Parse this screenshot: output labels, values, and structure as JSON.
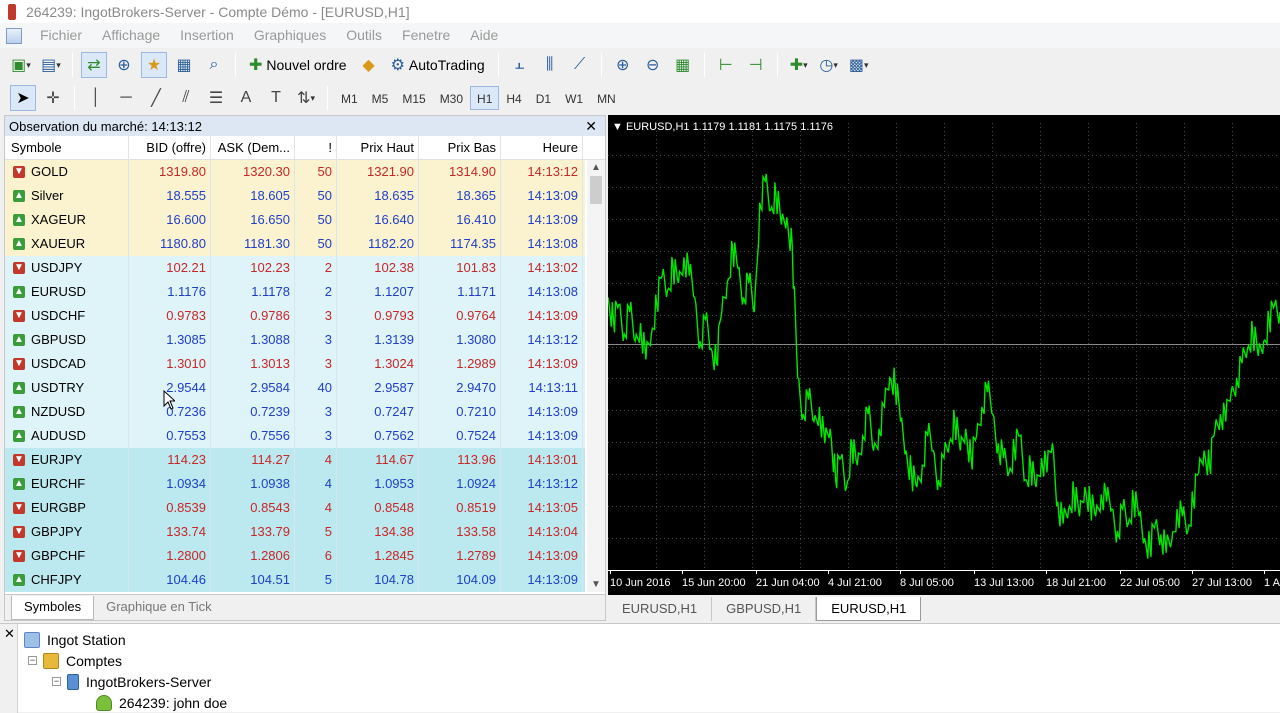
{
  "window": {
    "title": "264239: IngotBrokers-Server - Compte Démo - [EURUSD,H1]"
  },
  "menu": [
    "Fichier",
    "Affichage",
    "Insertion",
    "Graphiques",
    "Outils",
    "Fenetre",
    "Aide"
  ],
  "toolbar": {
    "new_order": "Nouvel ordre",
    "autotrading": "AutoTrading"
  },
  "periods": [
    "M1",
    "M5",
    "M15",
    "M30",
    "H1",
    "H4",
    "D1",
    "W1",
    "MN"
  ],
  "active_period": "H1",
  "market_watch": {
    "title": "Observation du marché: 14:13:12",
    "columns": {
      "symbol": "Symbole",
      "bid": "BID (offre)",
      "ask": "ASK (Dem...",
      "spread": "!",
      "high": "Prix Haut",
      "low": "Prix Bas",
      "time": "Heure"
    },
    "rows": [
      {
        "symbol": "GOLD",
        "dir": "down",
        "group": "metals",
        "bid": "1319.80",
        "ask": "1320.30",
        "spread": "50",
        "high": "1321.90",
        "low": "1314.90",
        "time": "14:13:12"
      },
      {
        "symbol": "Silver",
        "dir": "up",
        "group": "metals",
        "bid": "18.555",
        "ask": "18.605",
        "spread": "50",
        "high": "18.635",
        "low": "18.365",
        "time": "14:13:09"
      },
      {
        "symbol": "XAGEUR",
        "dir": "up",
        "group": "metals",
        "bid": "16.600",
        "ask": "16.650",
        "spread": "50",
        "high": "16.640",
        "low": "16.410",
        "time": "14:13:09"
      },
      {
        "symbol": "XAUEUR",
        "dir": "up",
        "group": "metals",
        "bid": "1180.80",
        "ask": "1181.30",
        "spread": "50",
        "high": "1182.20",
        "low": "1174.35",
        "time": "14:13:08"
      },
      {
        "symbol": "USDJPY",
        "dir": "down",
        "group": "majors",
        "bid": "102.21",
        "ask": "102.23",
        "spread": "2",
        "high": "102.38",
        "low": "101.83",
        "time": "14:13:02"
      },
      {
        "symbol": "EURUSD",
        "dir": "up",
        "group": "majors",
        "bid": "1.1176",
        "ask": "1.1178",
        "spread": "2",
        "high": "1.1207",
        "low": "1.1171",
        "time": "14:13:08"
      },
      {
        "symbol": "USDCHF",
        "dir": "down",
        "group": "majors",
        "bid": "0.9783",
        "ask": "0.9786",
        "spread": "3",
        "high": "0.9793",
        "low": "0.9764",
        "time": "14:13:09"
      },
      {
        "symbol": "GBPUSD",
        "dir": "up",
        "group": "majors",
        "bid": "1.3085",
        "ask": "1.3088",
        "spread": "3",
        "high": "1.3139",
        "low": "1.3080",
        "time": "14:13:12"
      },
      {
        "symbol": "USDCAD",
        "dir": "down",
        "group": "majors",
        "bid": "1.3010",
        "ask": "1.3013",
        "spread": "3",
        "high": "1.3024",
        "low": "1.2989",
        "time": "14:13:09"
      },
      {
        "symbol": "USDTRY",
        "dir": "up",
        "group": "majors",
        "bid": "2.9544",
        "ask": "2.9584",
        "spread": "40",
        "high": "2.9587",
        "low": "2.9470",
        "time": "14:13:11"
      },
      {
        "symbol": "NZDUSD",
        "dir": "up",
        "group": "majors",
        "bid": "0.7236",
        "ask": "0.7239",
        "spread": "3",
        "high": "0.7247",
        "low": "0.7210",
        "time": "14:13:09"
      },
      {
        "symbol": "AUDUSD",
        "dir": "up",
        "group": "majors",
        "bid": "0.7553",
        "ask": "0.7556",
        "spread": "3",
        "high": "0.7562",
        "low": "0.7524",
        "time": "14:13:09"
      },
      {
        "symbol": "EURJPY",
        "dir": "down",
        "group": "crosses",
        "bid": "114.23",
        "ask": "114.27",
        "spread": "4",
        "high": "114.67",
        "low": "113.96",
        "time": "14:13:01"
      },
      {
        "symbol": "EURCHF",
        "dir": "up",
        "group": "crosses",
        "bid": "1.0934",
        "ask": "1.0938",
        "spread": "4",
        "high": "1.0953",
        "low": "1.0924",
        "time": "14:13:12"
      },
      {
        "symbol": "EURGBP",
        "dir": "down",
        "group": "crosses",
        "bid": "0.8539",
        "ask": "0.8543",
        "spread": "4",
        "high": "0.8548",
        "low": "0.8519",
        "time": "14:13:05"
      },
      {
        "symbol": "GBPJPY",
        "dir": "down",
        "group": "crosses",
        "bid": "133.74",
        "ask": "133.79",
        "spread": "5",
        "high": "134.38",
        "low": "133.58",
        "time": "14:13:04"
      },
      {
        "symbol": "GBPCHF",
        "dir": "down",
        "group": "crosses",
        "bid": "1.2800",
        "ask": "1.2806",
        "spread": "6",
        "high": "1.2845",
        "low": "1.2789",
        "time": "14:13:09"
      },
      {
        "symbol": "CHFJPY",
        "dir": "up",
        "group": "crosses",
        "bid": "104.46",
        "ask": "104.51",
        "spread": "5",
        "high": "104.78",
        "low": "104.09",
        "time": "14:13:09"
      }
    ],
    "tabs": [
      "Symboles",
      "Graphique en Tick"
    ],
    "active_tab": "Symboles"
  },
  "chart": {
    "header": "EURUSD,H1  1.1179 1.1181 1.1175 1.1176",
    "x_ticks": [
      "10 Jun 2016",
      "15 Jun 20:00",
      "21 Jun 04:00",
      "4 Jul 21:00",
      "8 Jul 05:00",
      "13 Jul 13:00",
      "18 Jul 21:00",
      "22 Jul 05:00",
      "27 Jul 13:00",
      "1 A"
    ],
    "tabs": [
      "EURUSD,H1",
      "GBPUSD,H1",
      "EURUSD,H1"
    ],
    "active_tab_index": 2,
    "colors": {
      "background": "#000000",
      "line": "#00e600",
      "grid": "#3a4a4a",
      "text": "#ffffff"
    }
  },
  "chart_data": {
    "type": "line",
    "series": [
      {
        "values": [
          0.62,
          0.56,
          0.6,
          0.52,
          0.58,
          0.5,
          0.55,
          0.45,
          0.52,
          0.6,
          0.68,
          0.64,
          0.71,
          0.66,
          0.73,
          0.68,
          0.62,
          0.5,
          0.56,
          0.48,
          0.44,
          0.58,
          0.66,
          0.76,
          0.7,
          0.62,
          0.66,
          0.58,
          0.88,
          0.94,
          0.86,
          0.9,
          0.82,
          0.84,
          0.76,
          0.4,
          0.3,
          0.34,
          0.28,
          0.32,
          0.22,
          0.26,
          0.12,
          0.18,
          0.1,
          0.22,
          0.16,
          0.24,
          0.3,
          0.2,
          0.26,
          0.32,
          0.4,
          0.38,
          0.28,
          0.2,
          0.14,
          0.1,
          0.16,
          0.24,
          0.2,
          0.12,
          0.18,
          0.22,
          0.28,
          0.2,
          0.26,
          0.18,
          0.24,
          0.32,
          0.36,
          0.3,
          0.22,
          0.18,
          0.14,
          0.2,
          0.24,
          0.12,
          0.16,
          0.1,
          0.18,
          0.14,
          0.22,
          0.06,
          0.0,
          0.04,
          0.08,
          0.02,
          0.1,
          0.06,
          0.02,
          0.08,
          0.06,
          0.04,
          -0.02,
          0.04,
          0.0,
          0.06,
          0.02,
          -0.04,
          -0.06,
          0.0,
          -0.03,
          -0.08,
          -0.05,
          0.04,
          0.02,
          -0.02,
          0.06,
          0.14,
          0.2,
          0.16,
          0.26,
          0.3,
          0.28,
          0.36,
          0.4,
          0.44,
          0.48,
          0.52,
          0.46,
          0.5,
          0.56,
          0.6,
          0.58
        ]
      }
    ]
  },
  "navigator": {
    "root": "Ingot Station",
    "accounts": "Comptes",
    "server": "IngotBrokers-Server",
    "account": "264239: john doe"
  }
}
